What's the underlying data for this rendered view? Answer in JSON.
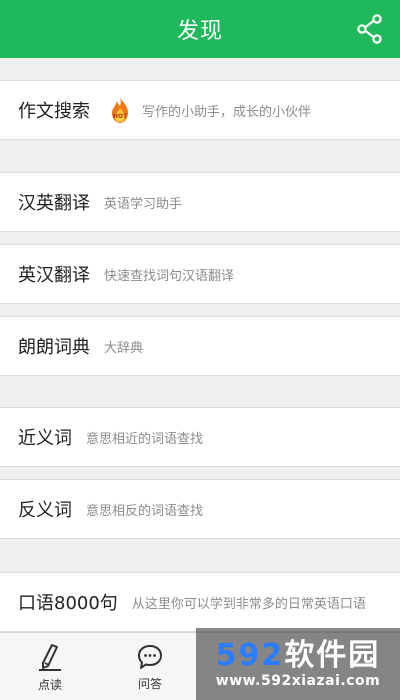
{
  "header": {
    "title": "发现",
    "share_icon": "share-icon"
  },
  "rows": [
    {
      "title": "作文搜索",
      "desc": "写作的小助手，成长的小伙伴",
      "badge": "hot"
    },
    {
      "title": "汉英翻译",
      "desc": "英语学习助手"
    },
    {
      "title": "英汉翻译",
      "desc": "快速查找词句汉语翻译"
    },
    {
      "title": "朗朗词典",
      "desc": "大辞典"
    },
    {
      "title": "近义词",
      "desc": "意思相近的词语查找"
    },
    {
      "title": "反义词",
      "desc": "意思相反的词语查找"
    },
    {
      "title": "口语8000句",
      "desc": "从这里你可以学到非常多的日常英语口语"
    }
  ],
  "tabs": [
    {
      "label": "点读",
      "icon": "pencil-icon"
    },
    {
      "label": "问答",
      "icon": "chat-bubble-icon"
    }
  ],
  "watermark": {
    "num": "592",
    "cn": "软件园",
    "url": "www.592xiazai.com"
  },
  "colors": {
    "accent": "#1fb85a",
    "background": "#efefef",
    "badge": "#f07a18"
  }
}
